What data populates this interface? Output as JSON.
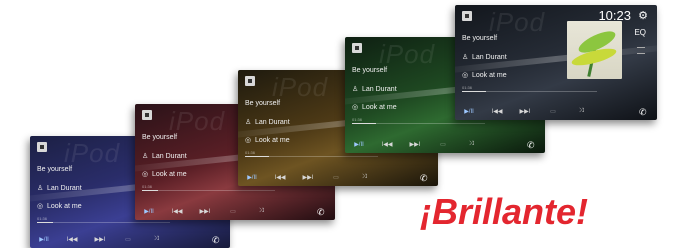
{
  "slogan": "¡Brillante!",
  "accent_color": "#e3262f",
  "watermark": "iPod",
  "screens": [
    {
      "theme": "blue",
      "song": "Be yourself",
      "artist": "Lan Durant",
      "album": "Look at me",
      "elapsed": "01:36",
      "progress": 0.12,
      "controls": {
        "play_pause": "▶/II",
        "prev": "I◀◀",
        "next": "▶▶I",
        "repeat": "▭",
        "shuffle": "⤨"
      }
    },
    {
      "theme": "red",
      "song": "Be yourself",
      "artist": "Lan Durant",
      "album": "Look at me",
      "elapsed": "01:36",
      "progress": 0.12,
      "controls": {
        "play_pause": "▶/II",
        "prev": "I◀◀",
        "next": "▶▶I",
        "repeat": "▭",
        "shuffle": "⤨"
      }
    },
    {
      "theme": "amber",
      "song": "Be yourself",
      "artist": "Lan Durant",
      "album": "Look at me",
      "elapsed": "01:36",
      "progress": 0.18,
      "controls": {
        "play_pause": "▶/II",
        "prev": "I◀◀",
        "next": "▶▶I",
        "repeat": "▭",
        "shuffle": "⤨"
      }
    },
    {
      "theme": "green",
      "song": "Be yourself",
      "artist": "Lan Durant",
      "album": "Look at me",
      "elapsed": "01:36",
      "progress": 0.18,
      "controls": {
        "play_pause": "▶/II",
        "prev": "I◀◀",
        "next": "▶▶I",
        "repeat": "▭",
        "shuffle": "⤨"
      }
    },
    {
      "theme": "slate",
      "song": "Be yourself",
      "artist": "Lan Durant",
      "album": "Look at me",
      "elapsed": "01:36",
      "progress": 0.18,
      "clock": "10:23",
      "eq_label": "EQ",
      "controls": {
        "play_pause": "▶/II",
        "prev": "I◀◀",
        "next": "▶▶I",
        "repeat": "▭",
        "shuffle": "⤨"
      }
    }
  ]
}
